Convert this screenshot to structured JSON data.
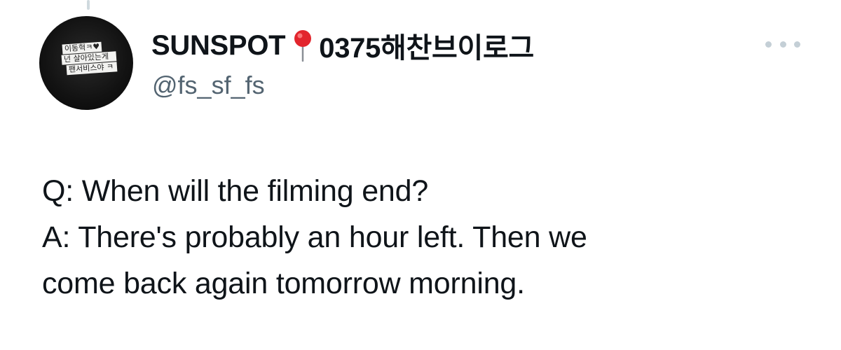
{
  "author": {
    "display_name": "SUNSPOT",
    "name_suffix": "0375해찬브이로그",
    "name_emoji": "pushpin-emoji",
    "handle": "@fs_sf_fs",
    "avatar_text": [
      "이동혁ㅋ♥",
      "넌 살아있는게",
      "팬서비스야 ㅋ"
    ]
  },
  "tweet": {
    "lines": [
      "Q: When will the filming end?",
      "A: There's probably an hour left. Then we",
      "come back again tomorrow morning."
    ]
  },
  "more_icon": "more-horizontal-icon",
  "colors": {
    "text": "#0f1419",
    "secondary": "#536471",
    "more_dots": "#c4cfd6",
    "thread_line": "#cfd9de",
    "pin": "#e2252d"
  }
}
